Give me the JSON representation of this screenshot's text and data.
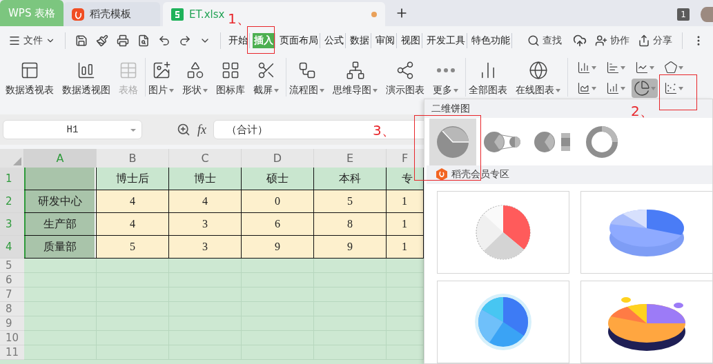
{
  "tabs": [
    {
      "label": "WPS 表格",
      "kind": "home",
      "selected": false
    },
    {
      "label": "稻壳模板",
      "kind": "docer",
      "selected": false
    },
    {
      "label": "ET.xlsx",
      "kind": "sheet",
      "selected": true,
      "unsaved": true
    }
  ],
  "window_count": "1",
  "menu": {
    "file": "文件",
    "tabs": [
      {
        "label": "开始",
        "selected": false
      },
      {
        "label": "插入",
        "selected": true
      },
      {
        "label": "页面布局",
        "selected": false
      },
      {
        "label": "公式",
        "selected": false
      },
      {
        "label": "数据",
        "selected": false
      },
      {
        "label": "审阅",
        "selected": false
      },
      {
        "label": "视图",
        "selected": false
      },
      {
        "label": "开发工具",
        "selected": false
      },
      {
        "label": "特色功能",
        "selected": false
      }
    ],
    "search": "查找",
    "actions": [
      {
        "label": "协作",
        "kind": "collab"
      },
      {
        "label": "分享",
        "kind": "share"
      }
    ]
  },
  "ribbon": {
    "groups": [
      [
        {
          "label": "数据透视表",
          "kind": "pivot",
          "dropdown": false,
          "disabled": false
        },
        {
          "label": "数据透视图",
          "kind": "pivot-chart",
          "dropdown": false,
          "disabled": false
        },
        {
          "label": "表格",
          "kind": "table",
          "dropdown": false,
          "disabled": true
        }
      ],
      [
        {
          "label": "图片",
          "kind": "image",
          "dropdown": true,
          "disabled": false
        },
        {
          "label": "形状",
          "kind": "shape",
          "dropdown": true,
          "disabled": false
        },
        {
          "label": "图标库",
          "kind": "icons",
          "dropdown": false,
          "disabled": false
        },
        {
          "label": "截屏",
          "kind": "screenshot",
          "dropdown": true,
          "disabled": false
        }
      ],
      [
        {
          "label": "流程图",
          "kind": "flow",
          "dropdown": true,
          "disabled": false
        },
        {
          "label": "思维导图",
          "kind": "mind",
          "dropdown": true,
          "disabled": false
        },
        {
          "label": "演示图表",
          "kind": "demo",
          "dropdown": false,
          "disabled": false
        },
        {
          "label": "更多",
          "kind": "more",
          "dropdown": true,
          "disabled": false
        }
      ],
      [
        {
          "label": "全部图表",
          "kind": "all-charts",
          "dropdown": false,
          "disabled": false
        },
        {
          "label": "在线图表",
          "kind": "online",
          "dropdown": true,
          "disabled": false
        }
      ]
    ],
    "chart_buttons": [
      {
        "kind": "column",
        "selected": false
      },
      {
        "kind": "bar",
        "selected": false
      },
      {
        "kind": "line",
        "selected": false
      },
      {
        "kind": "radar",
        "selected": false
      },
      {
        "kind": "area",
        "selected": false
      },
      {
        "kind": "combo",
        "selected": false
      },
      {
        "kind": "pie",
        "selected": true
      },
      {
        "kind": "scatter",
        "selected": false
      }
    ]
  },
  "formula_bar": {
    "name_box": "H1",
    "fx": "fx",
    "value": "（合计）"
  },
  "sheet": {
    "columns": [
      {
        "label": "A",
        "selected": true
      },
      {
        "label": "B",
        "selected": false
      },
      {
        "label": "C",
        "selected": false
      },
      {
        "label": "D",
        "selected": false
      },
      {
        "label": "E",
        "selected": false
      },
      {
        "label": "F",
        "selected": false
      }
    ],
    "rows": [
      {
        "header": "1",
        "selected": true,
        "cells": [
          "",
          "博士后",
          "博士",
          "硕士",
          "本科",
          "专"
        ]
      },
      {
        "header": "2",
        "selected": true,
        "cells": [
          "研发中心",
          "4",
          "4",
          "0",
          "5",
          "1"
        ]
      },
      {
        "header": "3",
        "selected": true,
        "cells": [
          "生产部",
          "4",
          "3",
          "6",
          "8",
          "1"
        ]
      },
      {
        "header": "4",
        "selected": true,
        "cells": [
          "质量部",
          "5",
          "3",
          "9",
          "9",
          "1"
        ]
      },
      {
        "header": "5",
        "selected": false,
        "cells": []
      },
      {
        "header": "6",
        "selected": false,
        "cells": []
      },
      {
        "header": "7",
        "selected": false,
        "cells": []
      },
      {
        "header": "8",
        "selected": false,
        "cells": []
      },
      {
        "header": "9",
        "selected": false,
        "cells": []
      },
      {
        "header": "10",
        "selected": false,
        "cells": []
      },
      {
        "header": "11",
        "selected": false,
        "cells": []
      }
    ]
  },
  "chart_menu": {
    "title": "二维饼图",
    "types": [
      {
        "kind": "pie",
        "selected": true
      },
      {
        "kind": "pie-of-pie",
        "selected": false
      },
      {
        "kind": "bar-of-pie",
        "selected": false
      },
      {
        "kind": "doughnut",
        "selected": false
      }
    ],
    "member_title": "稻壳会员专区",
    "templates": [
      {
        "kind": "flat"
      },
      {
        "kind": "tilted"
      },
      {
        "kind": "ring"
      },
      {
        "kind": "layered"
      }
    ]
  },
  "annotations": [
    {
      "label": "1、"
    },
    {
      "label": "2、"
    },
    {
      "label": "3、"
    }
  ]
}
